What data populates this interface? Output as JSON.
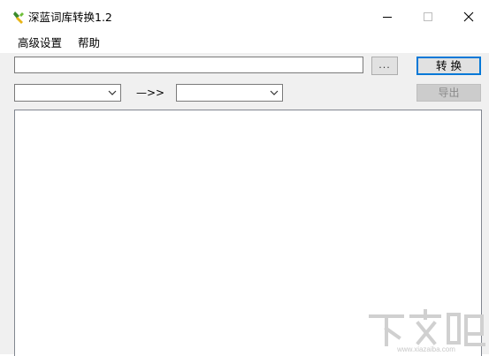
{
  "window": {
    "title": "深蓝词库转换1.2"
  },
  "menu": {
    "items": [
      "高级设置",
      "帮助"
    ]
  },
  "toolbar": {
    "path_value": "",
    "browse_label": "...",
    "convert_label": "转 换",
    "source_format": "",
    "arrow_label": "—>>",
    "target_format": "",
    "export_label": "导出"
  },
  "output": {
    "text": ""
  },
  "watermark": {
    "text": "下载吧",
    "url": "www.xiazaiba.com"
  },
  "colors": {
    "focus_border": "#0078d7",
    "surface": "#f0f0f0",
    "disabled": "#cccccc"
  }
}
